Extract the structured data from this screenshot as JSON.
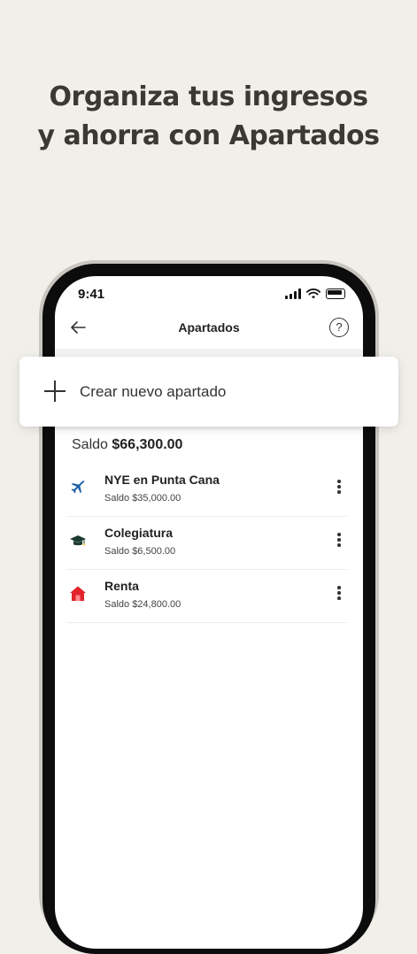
{
  "headline": {
    "line1": "Organiza tus ingresos",
    "line2": "y ahorra con Apartados"
  },
  "status_bar": {
    "time": "9:41"
  },
  "nav": {
    "title": "Apartados",
    "back_icon": "arrow-left-icon",
    "help_icon": "question-circle-icon",
    "help_glyph": "?"
  },
  "create": {
    "label": "Crear nuevo apartado",
    "icon": "plus-icon"
  },
  "balance": {
    "label": "Saldo",
    "amount": "$66,300.00"
  },
  "apartados": [
    {
      "title": "NYE en Punta Cana",
      "subtitle": "Saldo $35,000.00",
      "icon": "airplane-icon"
    },
    {
      "title": "Colegiatura",
      "subtitle": "Saldo $6,500.00",
      "icon": "graduation-cap-icon"
    },
    {
      "title": "Renta",
      "subtitle": "Saldo $24,800.00",
      "icon": "house-icon"
    }
  ],
  "colors": {
    "background": "#f1efea",
    "headline": "#3c3834",
    "plane": "#1f5fa8",
    "cap": "#1a3a2e",
    "house": "#e3232c"
  }
}
